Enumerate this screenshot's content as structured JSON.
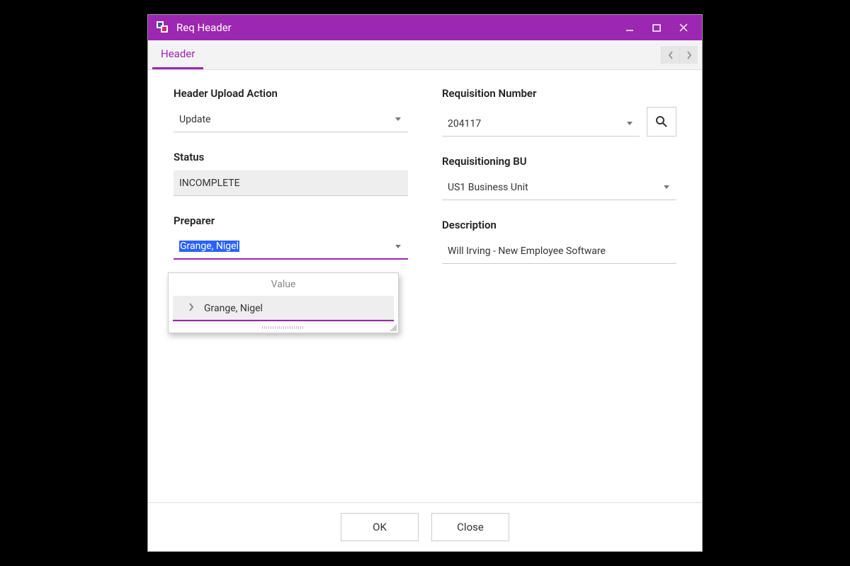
{
  "window": {
    "title": "Req Header"
  },
  "tabs": {
    "header": "Header"
  },
  "fields": {
    "uploadAction": {
      "label": "Header Upload Action",
      "value": "Update"
    },
    "status": {
      "label": "Status",
      "value": "INCOMPLETE"
    },
    "preparer": {
      "label": "Preparer",
      "value": "Grange, Nigel"
    },
    "reqNumber": {
      "label": "Requisition Number",
      "value": "204117"
    },
    "reqBU": {
      "label": "Requisitioning BU",
      "value": "US1 Business Unit"
    },
    "description": {
      "label": "Description",
      "value": "Will Irving - New Employee Software"
    }
  },
  "dropdown": {
    "header": "Value",
    "options": [
      "Grange, Nigel"
    ]
  },
  "buttons": {
    "ok": "OK",
    "close": "Close"
  },
  "colors": {
    "accent": "#9c27b0"
  }
}
